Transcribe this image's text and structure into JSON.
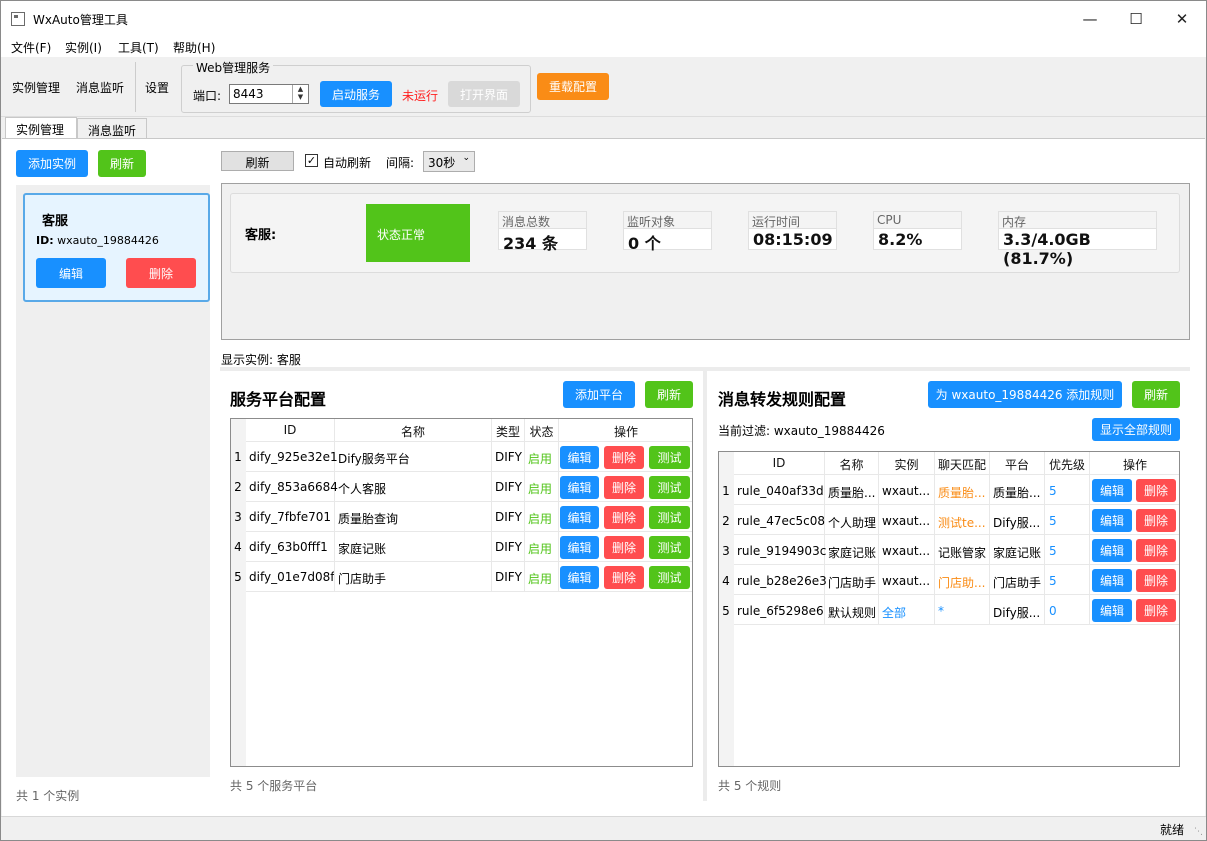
{
  "window": {
    "title": "WxAuto管理工具"
  },
  "menu": [
    "文件(F)",
    "实例(I)",
    "工具(T)",
    "帮助(H)"
  ],
  "toolbar": {
    "instance_mgmt": "实例管理",
    "msg_monitor": "消息监听",
    "settings": "设置",
    "web_group_title": "Web管理服务",
    "port_label": "端口:",
    "port_value": "8443",
    "start_service": "启动服务",
    "service_status": "未运行",
    "open_ui": "打开界面",
    "reload_config": "重载配置"
  },
  "tabs": [
    "实例管理",
    "消息监听"
  ],
  "left": {
    "add_instance": "添加实例",
    "refresh": "刷新",
    "instance": {
      "name": "客服",
      "id_label": "ID:",
      "id_value": "wxauto_19884426",
      "edit": "编辑",
      "delete": "删除"
    },
    "footer": "共 1 个实例"
  },
  "status": {
    "refresh": "刷新",
    "auto_refresh": "自动刷新",
    "interval_label": "间隔:",
    "interval_value": "30秒",
    "instance_name": "客服:",
    "state": "状态正常",
    "metrics": [
      {
        "label": "消息总数",
        "value": "234 条"
      },
      {
        "label": "监听对象",
        "value": "0 个"
      },
      {
        "label": "运行时间",
        "value": "08:15:09"
      },
      {
        "label": "CPU",
        "value": "8.2%"
      },
      {
        "label": "内存",
        "value": "3.3/4.0GB (81.7%)"
      }
    ],
    "showing": "显示实例: 客服"
  },
  "platforms": {
    "title": "服务平台配置",
    "add": "添加平台",
    "refresh": "刷新",
    "columns": [
      "ID",
      "名称",
      "类型",
      "状态",
      "操作"
    ],
    "rows": [
      {
        "n": "1",
        "id": "dify_925e32e1",
        "name": "Dify服务平台",
        "type": "DIFY",
        "state": "启用"
      },
      {
        "n": "2",
        "id": "dify_853a6684",
        "name": "个人客服",
        "type": "DIFY",
        "state": "启用"
      },
      {
        "n": "3",
        "id": "dify_7fbfe701",
        "name": "质量胎查询",
        "type": "DIFY",
        "state": "启用"
      },
      {
        "n": "4",
        "id": "dify_63b0fff1",
        "name": "家庭记账",
        "type": "DIFY",
        "state": "启用"
      },
      {
        "n": "5",
        "id": "dify_01e7d08f",
        "name": "门店助手",
        "type": "DIFY",
        "state": "启用"
      }
    ],
    "actions": {
      "edit": "编辑",
      "delete": "删除",
      "test": "测试"
    },
    "footer": "共 5 个服务平台"
  },
  "rules": {
    "title": "消息转发规则配置",
    "add": "为 wxauto_19884426 添加规则",
    "refresh": "刷新",
    "filter": "当前过滤: wxauto_19884426",
    "show_all": "显示全部规则",
    "columns": [
      "ID",
      "名称",
      "实例",
      "聊天匹配",
      "平台",
      "优先级",
      "操作"
    ],
    "rows": [
      {
        "n": "1",
        "id": "rule_040af33d",
        "name": "质量胎...",
        "inst": "wxaut...",
        "match": "质量胎...",
        "match_color": "orange",
        "platform": "质量胎...",
        "priority": "5"
      },
      {
        "n": "2",
        "id": "rule_47ec5c08",
        "name": "个人助理",
        "inst": "wxaut...",
        "match": "测试te...",
        "match_color": "orange",
        "platform": "Dify服...",
        "priority": "5"
      },
      {
        "n": "3",
        "id": "rule_9194903c",
        "name": "家庭记账",
        "inst": "wxaut...",
        "match": "记账管家",
        "match_color": "black",
        "platform": "家庭记账",
        "priority": "5"
      },
      {
        "n": "4",
        "id": "rule_b28e26e3",
        "name": "门店助手",
        "inst": "wxaut...",
        "match": "门店助...",
        "match_color": "orange",
        "platform": "门店助手",
        "priority": "5"
      },
      {
        "n": "5",
        "id": "rule_6f5298e6",
        "name": "默认规则",
        "inst": "全部",
        "inst_color": "blue",
        "match": "*",
        "match_color": "blue",
        "platform": "Dify服...",
        "priority": "0"
      }
    ],
    "actions": {
      "edit": "编辑",
      "delete": "删除"
    },
    "footer": "共 5 个规则"
  },
  "statusbar": {
    "text": "就绪"
  },
  "colors": {
    "blue": "#1890ff",
    "green": "#52c41a",
    "red": "#ff4d4f",
    "orange": "#fa8c16"
  }
}
